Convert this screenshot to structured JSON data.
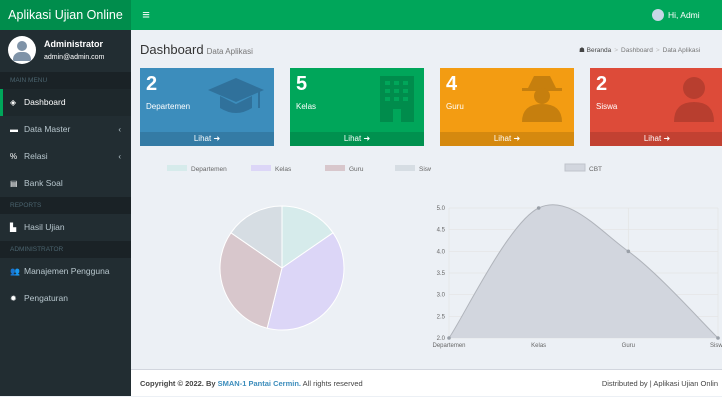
{
  "app": {
    "brand": "Aplikasi Ujian Online",
    "toggle_icon": "≡",
    "top_user": "Hi, Admi"
  },
  "user": {
    "name": "Administrator",
    "email": "admin@admin.com"
  },
  "sidebar": {
    "main_menu_header": "MAIN MENU",
    "reports_header": "REPORTS",
    "admin_header": "ADMINISTRATOR",
    "items": [
      {
        "label": "Dashboard",
        "icon": "dashboard-icon",
        "active": true
      },
      {
        "label": "Data Master",
        "icon": "folder-icon",
        "arrow": "‹"
      },
      {
        "label": "Relasi",
        "icon": "link-icon",
        "arrow": "‹"
      },
      {
        "label": "Bank Soal",
        "icon": "file-icon"
      },
      {
        "label": "Hasil Ujian",
        "icon": "file-icon"
      },
      {
        "label": "Manajemen Pengguna",
        "icon": "users-icon"
      },
      {
        "label": "Pengaturan",
        "icon": "gear-icon"
      }
    ]
  },
  "page": {
    "title": "Dashboard",
    "subtitle": "Data Aplikasi"
  },
  "breadcrumb": {
    "home": "Beranda",
    "current": "Dashboard",
    "last": "Data Aplikasi"
  },
  "boxes": [
    {
      "value": "2",
      "label": "Departemen",
      "link": "Lihat",
      "color": "#3c8dbc",
      "icon": "graduation-cap-icon"
    },
    {
      "value": "5",
      "label": "Kelas",
      "link": "Lihat",
      "color": "#00a65a",
      "icon": "building-icon"
    },
    {
      "value": "4",
      "label": "Guru",
      "link": "Lihat",
      "color": "#f39c12",
      "icon": "user-secret-icon"
    },
    {
      "value": "2",
      "label": "Siswa",
      "link": "Lihat",
      "color": "#dd4b39",
      "icon": "user-icon"
    }
  ],
  "chart_data": [
    {
      "type": "pie",
      "categories": [
        "Departemen",
        "Kelas",
        "Guru",
        "Siswa"
      ],
      "values": [
        2,
        5,
        4,
        2
      ],
      "colors": [
        "#d6ebeb",
        "#dcd6f7",
        "#d8c7cc",
        "#d6dde3"
      ],
      "legend": "top"
    },
    {
      "type": "area",
      "categories": [
        "Departemen",
        "Kelas",
        "Guru",
        "Siswa"
      ],
      "series": [
        {
          "name": "CBT",
          "values": [
            2,
            5,
            4,
            2
          ]
        }
      ],
      "ylim": [
        2,
        5
      ],
      "yticks": [
        "2.0",
        "2.5",
        "3.0",
        "3.5",
        "4.0",
        "4.5",
        "5.0"
      ],
      "grid": true,
      "legend": "top"
    }
  ],
  "footer": {
    "copyright": "Copyright © 2022. By",
    "org": "SMAN-1 Pantai Cermin.",
    "rights": "All rights reserved",
    "right": "Distributed by | Aplikasi Ujian Onlin"
  }
}
